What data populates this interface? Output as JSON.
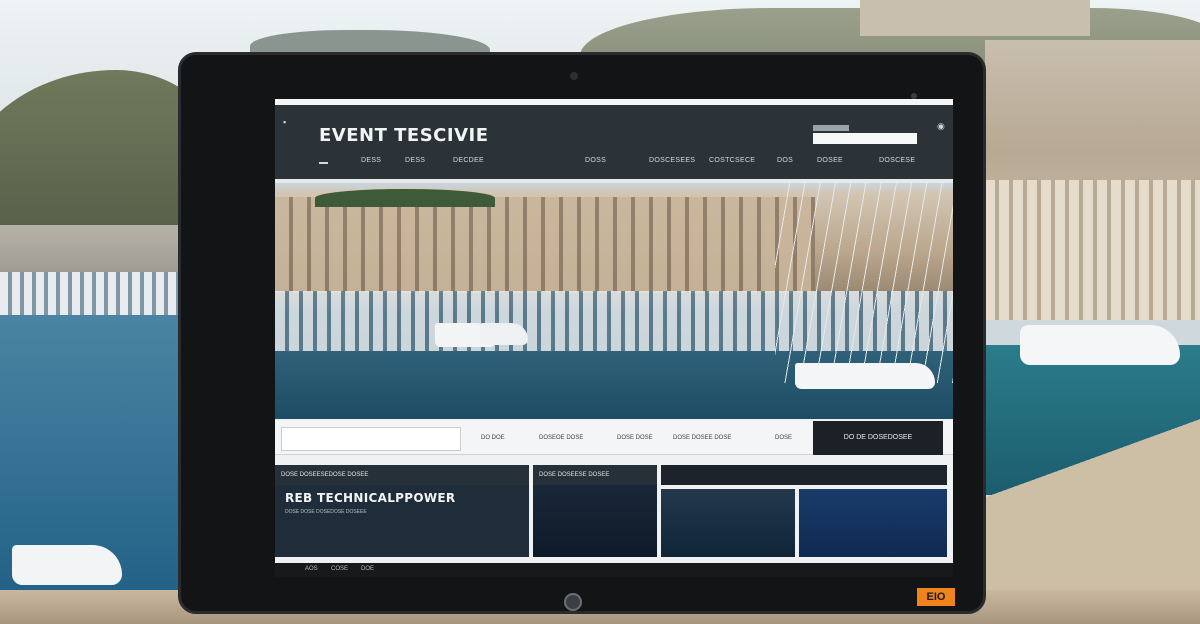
{
  "site": {
    "brand": "EVENT TESCIVIE",
    "nav": [
      "DESS",
      "DESS",
      "DECDEE",
      "DOSS",
      "DOSCESEES",
      "COSTCSECE",
      "DOS",
      "DOSEE",
      "DOSCESE"
    ],
    "subnav": {
      "search_text": "",
      "links": [
        "DO DOE",
        "DOSEOE DOSE",
        "DOSE DOSE",
        "DOSE DOSEE DOSE",
        "DOSE"
      ],
      "cta_label": "DO DE DOSEDOSEE"
    },
    "panels": {
      "main_bar": "DOSE DOSEESEDOSE DOSEE",
      "main_title": "REB TECHNICALPPOWER",
      "main_sub": "DOSE DOSE DOSEDOSE DOSEEE",
      "second_bar": "DOSE DOSEESE DOSEE"
    },
    "footer": [
      "AOS",
      "COSE",
      "DOE"
    ]
  },
  "device": {
    "badge": "EIO"
  }
}
